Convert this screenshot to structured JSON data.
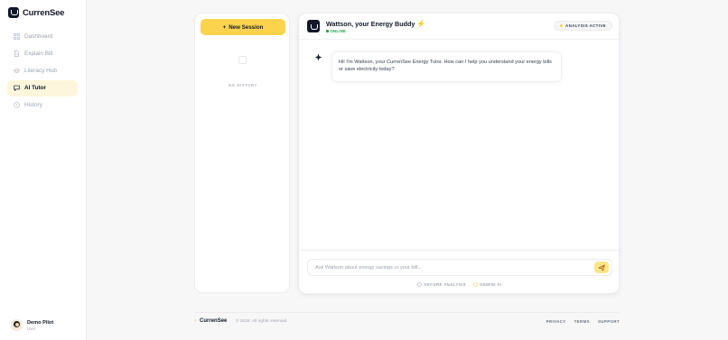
{
  "brand": {
    "name": "CurrenSee"
  },
  "nav": {
    "items": [
      {
        "label": "Dashboard",
        "icon": "grid-icon",
        "active": false
      },
      {
        "label": "Explain Bill",
        "icon": "document-icon",
        "active": false
      },
      {
        "label": "Literacy Hub",
        "icon": "graduation-cap-icon",
        "active": false
      },
      {
        "label": "AI Tutor",
        "icon": "chat-bubble-icon",
        "active": true
      },
      {
        "label": "History",
        "icon": "clock-icon",
        "active": false
      }
    ]
  },
  "user": {
    "name": "Demo Pilot",
    "role": "User"
  },
  "sessions": {
    "new_label": "New Session",
    "empty_label": "NO HISTORY"
  },
  "chat": {
    "title": "Wattson, your Energy Buddy",
    "status": "ONLINE",
    "badge": "ANALYSIS ACTIVE",
    "messages": [
      {
        "from": "bot",
        "text": "Hi! I'm Wattson, your CurrenSee Energy Tutor. How can I help you understand your energy bills or save electricity today?"
      }
    ],
    "input_placeholder": "Ask Wattson about energy savings or your bill...",
    "tags": [
      "SECURE ANALYSIS",
      "GEMINI AI"
    ]
  },
  "footer": {
    "brand": "CurrenSee",
    "copyright": "© 2026. All rights reserved.",
    "links": [
      "PRIVACY",
      "TERMS",
      "SUPPORT"
    ]
  },
  "colors": {
    "accent": "#fcd34d",
    "online": "#16a34a",
    "active_bg": "#fef6dc"
  }
}
